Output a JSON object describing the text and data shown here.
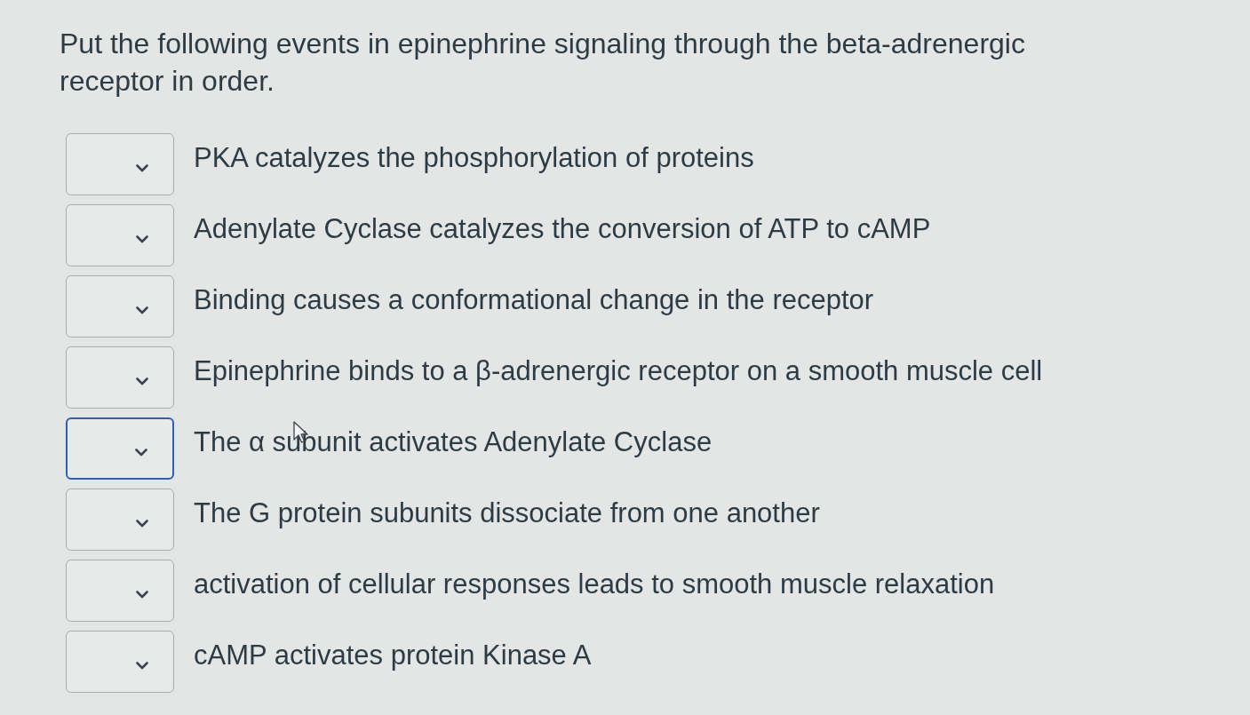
{
  "question": {
    "prompt": "Put the following events in epinephrine signaling through the beta-adrenergic receptor in order."
  },
  "items": [
    {
      "text": "PKA catalyzes the phosphorylation of proteins",
      "focused": false,
      "hovered": false
    },
    {
      "text": "Adenylate Cyclase catalyzes the conversion of ATP to cAMP",
      "focused": false,
      "hovered": false
    },
    {
      "text": "Binding causes a conformational change in the receptor",
      "focused": false,
      "hovered": false
    },
    {
      "text": "Epinephrine binds to a β-adrenergic receptor on a smooth muscle cell",
      "focused": false,
      "hovered": false
    },
    {
      "text": "The α subunit activates Adenylate Cyclase",
      "focused": true,
      "hovered": true
    },
    {
      "text": "The G protein subunits dissociate from one another",
      "focused": false,
      "hovered": false
    },
    {
      "text": "activation of cellular responses leads to smooth muscle relaxation",
      "focused": false,
      "hovered": false
    },
    {
      "text": "cAMP activates protein Kinase A",
      "focused": false,
      "hovered": false
    }
  ]
}
